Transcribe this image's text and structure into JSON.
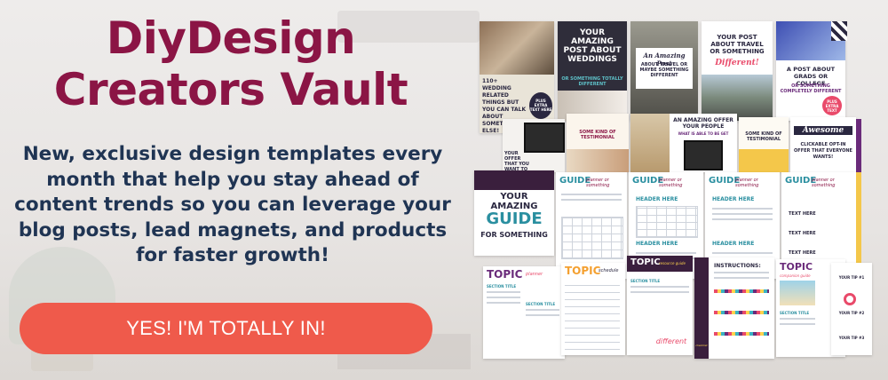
{
  "banner": {
    "title_line1": "DiyDesign",
    "title_line2": "Creators Vault",
    "description": "New, exclusive design templates every month that help you stay ahead of content trends so you can leverage your blog posts, lead magnets, and products for faster growth!",
    "cta_label": "YES! I'M TOTALLY IN!",
    "colors": {
      "title": "#8b1545",
      "body": "#1f3453",
      "cta": "#ef5a4b",
      "cta_text": "#ffffff"
    }
  },
  "collage": {
    "tiles": {
      "weddings_things": "110+ WEDDING RELATED THINGS BUT YOU CAN TALK ABOUT SOMETHING ELSE!",
      "weddings_badge": "PLUS EXTRA TEXT HERE",
      "amazing_post": "YOUR AMAZING POST ABOUT WEDDINGS",
      "amazing_post_sub": "OR SOMETHING TOTALLY DIFFERENT",
      "travel_script": "An Amazing Post",
      "travel": "ABOUT TRAVEL OR MAYBE SOMETHING DIFFERENT",
      "travel2": "YOUR POST ABOUT TRAVEL OR SOMETHING",
      "travel2_script": "Different!",
      "grads": "A POST ABOUT GRADS OR COLLEGE",
      "grads_sub": "OR SOMETHING COMPLETELY DIFFERENT",
      "grads_badge": "PLUS EXTRA TEXT",
      "offer": "YOUR OFFER THAT YOU WANT TO",
      "testimonial": "SOME KIND OF TESTIMONIAL",
      "offer_people": "AN AMAZING OFFER YOUR PEOPLE",
      "offer_people_sub": "WHAT IS ABLE TO BE GET",
      "testimonial2": "SOME KIND OF TESTIMONIAL",
      "awesome": "Awesome",
      "clickable": "CLICKABLE OPT-IN OFFER THAT EVERYONE WANTS!",
      "guide_cover_1": "YOUR AMAZING",
      "guide_cover_2": "GUIDE",
      "guide_cover_3": "FOR SOMETHING",
      "guide_label": "GUIDE",
      "guide_script": "planner or something",
      "header_here": "HEADER HERE",
      "topic": "TOPIC",
      "topic_script_1": "planner",
      "topic_script_2": "schedule",
      "topic_script_3": "resource guide",
      "topic_script_4": "checklist",
      "topic_script_5": "companion guide",
      "section_title": "SECTION TITLE",
      "instructions": "INSTRUCTIONS:",
      "text_here": "TEXT HERE",
      "your_tip_1": "YOUR TIP #1",
      "your_tip_2": "YOUR TIP #2",
      "your_tip_3": "YOUR TIP #3",
      "different": "different"
    }
  }
}
